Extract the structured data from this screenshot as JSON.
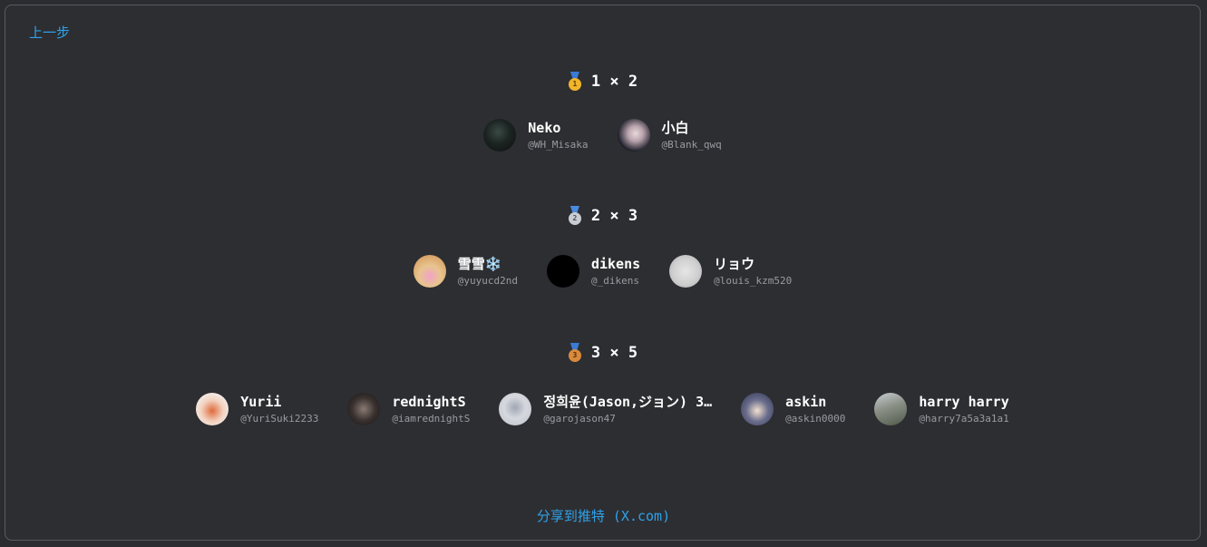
{
  "nav": {
    "back_label": "上一步"
  },
  "tiers": [
    {
      "heading": "1 × 2",
      "medal": "gold-medal-icon",
      "medal_number": "1",
      "users": [
        {
          "name": "Neko",
          "handle": "@WH_Misaka"
        },
        {
          "name": "小白",
          "handle": "@Blank_qwq"
        }
      ]
    },
    {
      "heading": "2 × 3",
      "medal": "silver-medal-icon",
      "medal_number": "2",
      "users": [
        {
          "name": "雪雪❄️",
          "handle": "@yuyucd2nd"
        },
        {
          "name": "dikens",
          "handle": "@_dikens"
        },
        {
          "name": "リョウ",
          "handle": "@louis_kzm520"
        }
      ]
    },
    {
      "heading": "3 × 5",
      "medal": "bronze-medal-icon",
      "medal_number": "3",
      "users": [
        {
          "name": "Yurii",
          "handle": "@YuriSuki2233"
        },
        {
          "name": "rednightS",
          "handle": "@iamrednightS"
        },
        {
          "name": "정희윤(Jason,ジョン) 3…",
          "handle": "@garojason47"
        },
        {
          "name": "askin",
          "handle": "@askin0000"
        },
        {
          "name": "harry harry",
          "handle": "@harry7a5a3a1a1"
        }
      ]
    }
  ],
  "share": {
    "label": "分享到推特 (X.com)"
  },
  "colors": {
    "accent": "#2ea2ea",
    "background": "#2d2e32",
    "handle": "#9a9ba0"
  }
}
